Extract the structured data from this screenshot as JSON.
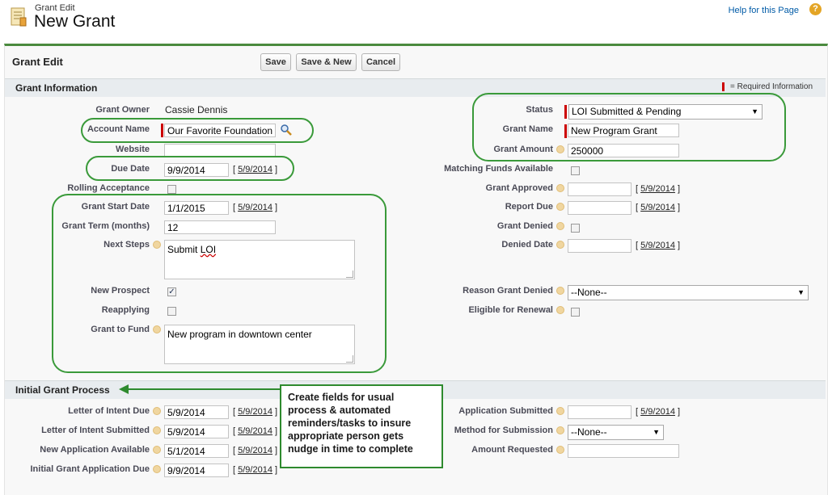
{
  "header": {
    "breadcrumb": "Grant Edit",
    "title": "New Grant",
    "help_link": "Help for this Page",
    "help_icon": "?"
  },
  "form": {
    "title": "Grant Edit",
    "save": "Save",
    "save_new": "Save & New",
    "cancel": "Cancel"
  },
  "section1": {
    "title": "Grant Information",
    "required_note": "= Required Information"
  },
  "left": {
    "grant_owner_label": "Grant Owner",
    "grant_owner": "Cassie Dennis",
    "account_name_label": "Account Name",
    "account_name": "Our Favorite Foundation",
    "website_label": "Website",
    "website": "",
    "due_date_label": "Due Date",
    "due_date": "9/9/2014",
    "due_date_link": "5/9/2014",
    "rolling_label": "Rolling Acceptance",
    "start_label": "Grant Start Date",
    "start": "1/1/2015",
    "start_link": "5/9/2014",
    "term_label": "Grant Term (months)",
    "term": "12",
    "next_steps_label": "Next Steps",
    "next_steps_pre": "Submit ",
    "next_steps_word": "LOI",
    "new_prospect_label": "New Prospect",
    "new_prospect_check": "✓",
    "reapplying_label": "Reapplying",
    "fund_label": "Grant to Fund",
    "fund": "New program in downtown center"
  },
  "right": {
    "status_label": "Status",
    "status": "LOI Submitted & Pending",
    "grant_name_label": "Grant Name",
    "grant_name": "New Program Grant",
    "amount_label": "Grant Amount",
    "amount": "250000",
    "matching_label": "Matching Funds Available",
    "approved_label": "Grant Approved",
    "approved_link": "5/9/2014",
    "report_label": "Report Due",
    "report_link": "5/9/2014",
    "denied_label": "Grant Denied",
    "denied_date_label": "Denied Date",
    "denied_date_link": "5/9/2014",
    "reason_label": "Reason Grant Denied",
    "reason": "--None--",
    "renewal_label": "Eligible for Renewal"
  },
  "section2": {
    "title": "Initial Grant Process",
    "loi_due_label": "Letter of Intent Due",
    "loi_due": "5/9/2014",
    "loi_due_link": "5/9/2014",
    "loi_sub_label": "Letter of Intent Submitted",
    "loi_sub": "5/9/2014",
    "loi_sub_link": "5/9/2014",
    "new_app_label": "New Application Available",
    "new_app": "5/1/2014",
    "new_app_link": "5/9/2014",
    "init_app_label": "Initial Grant Application Due",
    "init_app": "9/9/2014",
    "init_app_link": "5/9/2014",
    "app_sub_label": "Application Submitted",
    "app_sub_link": "5/9/2014",
    "method_label": "Method for Submission",
    "method": "--None--",
    "amount_req_label": "Amount Requested"
  },
  "callout": {
    "text": "Create fields for usual process & automated reminders/tasks to insure appropriate person gets nudge in time to complete"
  },
  "colors": {
    "accent": "#4a8a3e",
    "annotation": "#2e8a2e",
    "required": "#cc0000",
    "link": "#015ba7"
  },
  "icons": [
    "grant-record-icon",
    "help-icon",
    "lookup-icon",
    "info-icon",
    "dropdown-arrow-icon",
    "textarea-resize-icon"
  ]
}
